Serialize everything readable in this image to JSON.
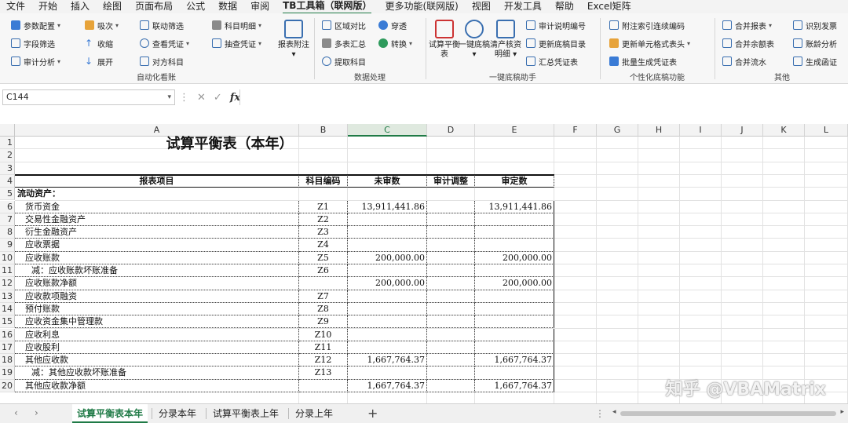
{
  "menu": [
    "文件",
    "开始",
    "插入",
    "绘图",
    "页面布局",
    "公式",
    "数据",
    "审阅",
    "TB工具箱（联网版）",
    "更多功能(联网版)",
    "视图",
    "开发工具",
    "帮助",
    "Excel矩阵"
  ],
  "ribbon": {
    "g1": {
      "label": "自动化看账",
      "items": [
        "参数配置",
        "吸次",
        "联动筛选",
        "科目明细",
        "字段筛选",
        "收缩",
        "查看凭证",
        "抽查凭证",
        "审计分析",
        "展开",
        "对方科目"
      ],
      "big": "报表附注"
    },
    "g2": {
      "label": "数据处理",
      "items": [
        "区域对比",
        "穿透",
        "多表汇总",
        "转换",
        "提取科目"
      ]
    },
    "g3": {
      "label": "一键底稿助手",
      "big": [
        "试算平衡表",
        "一键底稿",
        "清产核资明细"
      ],
      "items": [
        "审计说明编号",
        "更新底稿目录",
        "汇总凭证表"
      ]
    },
    "g4": {
      "label": "个性化底稿功能",
      "items": [
        "附注索引连续编码",
        "更新单元格式表头",
        "批量生成凭证表"
      ]
    },
    "g5": {
      "label": "其他",
      "items": [
        "合并报表",
        "识别发票",
        "合并余额表",
        "账龄分析",
        "合并流水",
        "生成函证"
      ]
    }
  },
  "formula_bar": {
    "name_box": "C144",
    "fx": "fx",
    "formula": ""
  },
  "columns": [
    "A",
    "B",
    "C",
    "D",
    "E",
    "F",
    "G",
    "H",
    "I",
    "J",
    "K",
    "L"
  ],
  "rows": [
    "1",
    "2",
    "3",
    "4",
    "5",
    "6",
    "7",
    "8",
    "9",
    "10",
    "11",
    "12",
    "13",
    "14",
    "15",
    "16",
    "17",
    "18",
    "19",
    "20"
  ],
  "sheet": {
    "title": "试算平衡表（本年）",
    "headers": [
      "报表项目",
      "科目编码",
      "未审数",
      "审计调整",
      "审定数"
    ],
    "section": "流动资产：",
    "data": [
      {
        "item": "货币资金",
        "code": "Z1",
        "unaudited": "13,911,441.86",
        "adj": "",
        "audited": "13,911,441.86"
      },
      {
        "item": "交易性金融资产",
        "code": "Z2",
        "unaudited": "",
        "adj": "",
        "audited": ""
      },
      {
        "item": "衍生金融资产",
        "code": "Z3",
        "unaudited": "",
        "adj": "",
        "audited": ""
      },
      {
        "item": "应收票据",
        "code": "Z4",
        "unaudited": "",
        "adj": "",
        "audited": ""
      },
      {
        "item": "应收账款",
        "code": "Z5",
        "unaudited": "200,000.00",
        "adj": "",
        "audited": "200,000.00"
      },
      {
        "item": "减：应收账款坏账准备",
        "code": "Z6",
        "unaudited": "",
        "adj": "",
        "audited": ""
      },
      {
        "item": "应收账款净额",
        "code": "",
        "unaudited": "200,000.00",
        "adj": "",
        "audited": "200,000.00"
      },
      {
        "item": "应收款项融资",
        "code": "Z7",
        "unaudited": "",
        "adj": "",
        "audited": ""
      },
      {
        "item": "预付账款",
        "code": "Z8",
        "unaudited": "",
        "adj": "",
        "audited": ""
      },
      {
        "item": "应收资金集中管理款",
        "code": "Z9",
        "unaudited": "",
        "adj": "",
        "audited": ""
      },
      {
        "item": "应收利息",
        "code": "Z10",
        "unaudited": "",
        "adj": "",
        "audited": ""
      },
      {
        "item": "应收股利",
        "code": "Z11",
        "unaudited": "",
        "adj": "",
        "audited": ""
      },
      {
        "item": "其他应收款",
        "code": "Z12",
        "unaudited": "1,667,764.37",
        "adj": "",
        "audited": "1,667,764.37"
      },
      {
        "item": "减：其他应收款坏账准备",
        "code": "Z13",
        "unaudited": "",
        "adj": "",
        "audited": ""
      },
      {
        "item": "其他应收款净额",
        "code": "",
        "unaudited": "1,667,764.37",
        "adj": "",
        "audited": "1,667,764.37"
      }
    ]
  },
  "watermark": "知乎 @VBAMatrix",
  "tabs": [
    "试算平衡表本年",
    "分录本年",
    "试算平衡表上年",
    "分录上年"
  ],
  "active_tab": "试算平衡表本年",
  "add_sheet": "+"
}
